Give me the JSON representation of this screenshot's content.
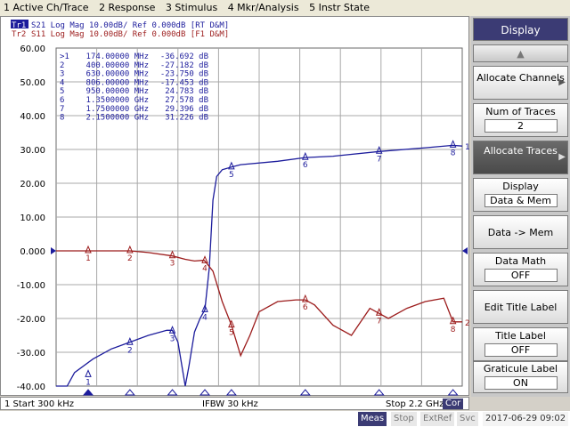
{
  "menu": [
    "1 Active Ch/Trace",
    "2 Response",
    "3 Stimulus",
    "4 Mkr/Analysis",
    "5 Instr State"
  ],
  "traces": {
    "tr1": {
      "id": "Tr1",
      "text": "S21 Log Mag 10.00dB/ Ref 0.000dB [RT D&M]",
      "color": "#1c1c9c"
    },
    "tr2": {
      "id": "Tr2",
      "text": "S11 Log Mag 10.00dB/ Ref 0.000dB [F1 D&M]",
      "color": "#9c1c1c"
    }
  },
  "marker_table": [
    {
      "idx": ">1",
      "freq": "174.00000 MHz",
      "val": "-36.692 dB"
    },
    {
      "idx": "2",
      "freq": "400.00000 MHz",
      "val": "-27.182 dB"
    },
    {
      "idx": "3",
      "freq": "630.00000 MHz",
      "val": "-23.750 dB"
    },
    {
      "idx": "4",
      "freq": "806.00000 MHz",
      "val": "-17.453 dB"
    },
    {
      "idx": "5",
      "freq": "950.00000 MHz",
      "val": "24.783 dB"
    },
    {
      "idx": "6",
      "freq": "1.3500000 GHz",
      "val": "27.578 dB"
    },
    {
      "idx": "7",
      "freq": "1.7500000 GHz",
      "val": "29.396 dB"
    },
    {
      "idx": "8",
      "freq": "2.1500000 GHz",
      "val": "31.226 dB"
    }
  ],
  "chart_data": {
    "type": "line",
    "x_unit": "GHz",
    "xlim": [
      0.0003,
      2.2
    ],
    "ylim": [
      -40,
      60
    ],
    "y_ticks": [
      "60.00",
      "50.00",
      "40.00",
      "30.00",
      "20.00",
      "10.00",
      "0.000",
      "-10.00",
      "-20.00",
      "-30.00",
      "-40.00"
    ],
    "grid": true,
    "series": [
      {
        "name": "S21",
        "color": "#1c1c9c",
        "x": [
          0.0003,
          0.06,
          0.1,
          0.2,
          0.3,
          0.4,
          0.5,
          0.6,
          0.63,
          0.66,
          0.7,
          0.72,
          0.75,
          0.78,
          0.8,
          0.806,
          0.83,
          0.85,
          0.87,
          0.9,
          0.95,
          1.0,
          1.2,
          1.35,
          1.5,
          1.75,
          2.0,
          2.15,
          2.2
        ],
        "y": [
          -40,
          -40,
          -36,
          -32,
          -29,
          -27,
          -25,
          -23.5,
          -23.5,
          -27,
          -40,
          -34,
          -24,
          -20,
          -18,
          -17.5,
          -5,
          15,
          22,
          24,
          24.8,
          25.5,
          26.5,
          27.6,
          28,
          29.4,
          30.5,
          31.2,
          31
        ],
        "end_label": "1"
      },
      {
        "name": "S11",
        "color": "#9c1c1c",
        "x": [
          0.0003,
          0.1,
          0.174,
          0.3,
          0.4,
          0.5,
          0.63,
          0.7,
          0.75,
          0.8,
          0.806,
          0.85,
          0.9,
          0.95,
          1.0,
          1.05,
          1.1,
          1.2,
          1.3,
          1.35,
          1.4,
          1.5,
          1.6,
          1.7,
          1.75,
          1.8,
          1.9,
          2.0,
          2.1,
          2.15,
          2.2
        ],
        "y": [
          0,
          0,
          0,
          0,
          0,
          -0.5,
          -1.5,
          -2.5,
          -3,
          -2.8,
          -3,
          -6,
          -15,
          -22,
          -31,
          -25,
          -18,
          -15,
          -14.5,
          -14.5,
          -16,
          -22,
          -25,
          -17,
          -18.5,
          -20,
          -17,
          -15,
          -14,
          -21,
          -21
        ],
        "end_label": "2"
      }
    ],
    "markers": [
      {
        "n": "1",
        "x": 0.174,
        "y": -36.692,
        "trace": "S21"
      },
      {
        "n": "2",
        "x": 0.4,
        "y": -27.182,
        "trace": "S21"
      },
      {
        "n": "3",
        "x": 0.63,
        "y": -23.75,
        "trace": "S21"
      },
      {
        "n": "4",
        "x": 0.806,
        "y": -17.453,
        "trace": "S21"
      },
      {
        "n": "5",
        "x": 0.95,
        "y": 24.783,
        "trace": "S21"
      },
      {
        "n": "6",
        "x": 1.35,
        "y": 27.578,
        "trace": "S21"
      },
      {
        "n": "7",
        "x": 1.75,
        "y": 29.396,
        "trace": "S21"
      },
      {
        "n": "8",
        "x": 2.15,
        "y": 31.226,
        "trace": "S21"
      },
      {
        "n": "1",
        "x": 0.174,
        "y": 0.0,
        "trace": "S11"
      },
      {
        "n": "2",
        "x": 0.4,
        "y": 0.0,
        "trace": "S11"
      },
      {
        "n": "3",
        "x": 0.63,
        "y": -1.5,
        "trace": "S11"
      },
      {
        "n": "4",
        "x": 0.806,
        "y": -3.0,
        "trace": "S11"
      },
      {
        "n": "5",
        "x": 0.95,
        "y": -22.0,
        "trace": "S11"
      },
      {
        "n": "6",
        "x": 1.35,
        "y": -14.5,
        "trace": "S11"
      },
      {
        "n": "7",
        "x": 1.75,
        "y": -18.5,
        "trace": "S11"
      },
      {
        "n": "8",
        "x": 2.15,
        "y": -21.0,
        "trace": "S11"
      }
    ]
  },
  "softkeys": {
    "title": "Display",
    "allocate_channels": "Allocate Channels",
    "num_traces_label": "Num of Traces",
    "num_traces_value": "2",
    "allocate_traces": "Allocate Traces",
    "display_label": "Display",
    "display_value": "Data & Mem",
    "data_to_mem": "Data -> Mem",
    "data_math_label": "Data Math",
    "data_math_value": "OFF",
    "edit_title": "Edit Title Label",
    "title_label": "Title Label",
    "title_label_value": "OFF",
    "graticule_label": "Graticule Label",
    "graticule_value": "ON"
  },
  "status": {
    "start": "1  Start 300 kHz",
    "ifbw": "IFBW 30 kHz",
    "stop": "Stop 2.2 GHz",
    "cor": "Cor"
  },
  "bottom": {
    "meas": "Meas",
    "stop": "Stop",
    "extref": "ExtRef",
    "svc": "Svc",
    "datetime": "2017-06-29 09:02"
  }
}
